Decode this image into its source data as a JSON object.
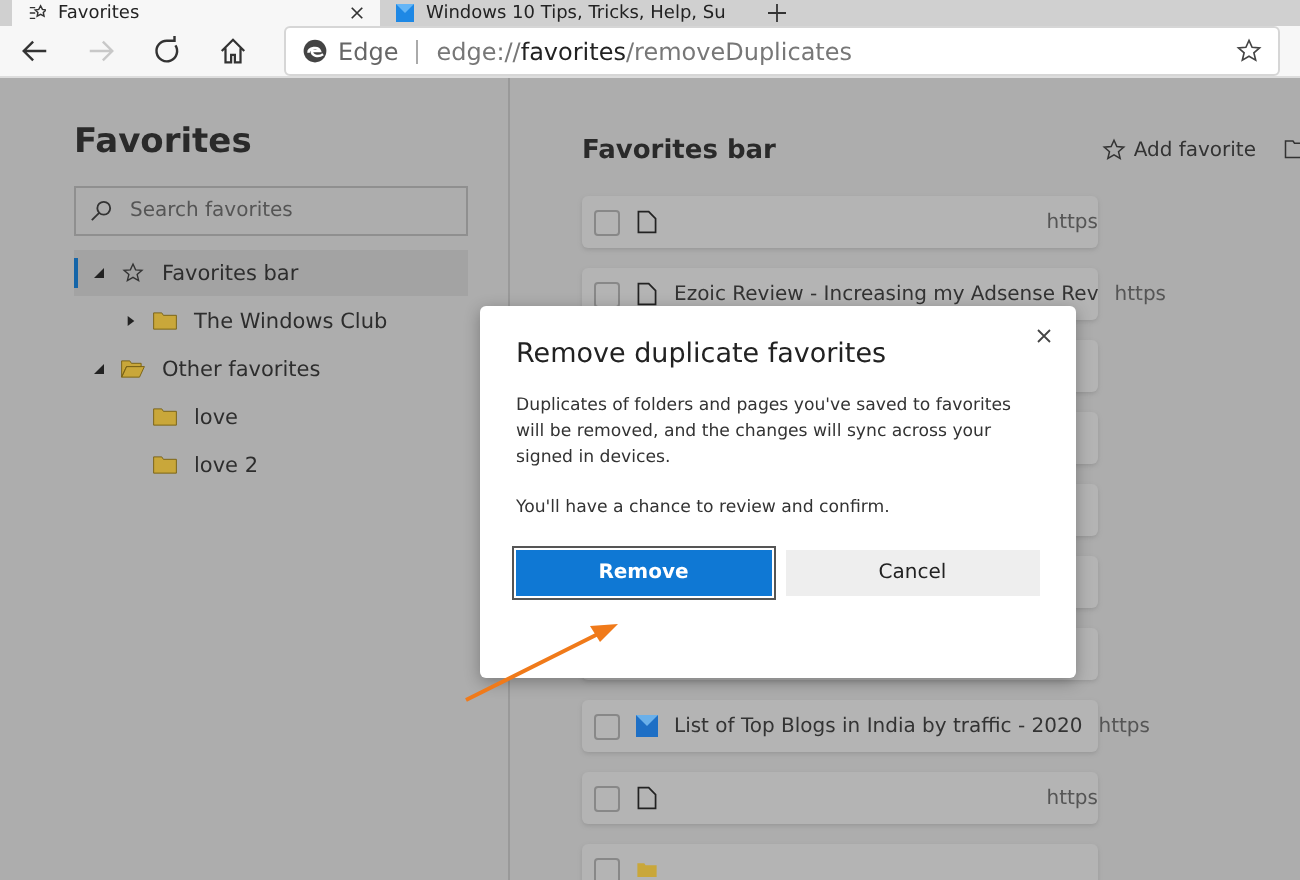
{
  "tabs": [
    {
      "label": "Favorites",
      "selected": true
    },
    {
      "label": "Windows 10 Tips, Tricks, Help, Su",
      "selected": false
    }
  ],
  "toolbar": {
    "forward_disabled": true,
    "address": {
      "brand": "Edge",
      "url": "edge://**favorites**/removeDuplicates"
    }
  },
  "sidebar": {
    "title": "Favorites",
    "search": {
      "placeholder": "Search favorites"
    },
    "tree": [
      {
        "label": "Favorites bar",
        "kind": "star",
        "selected": true,
        "expanded": true,
        "children": [
          {
            "label": "The Windows Club",
            "kind": "folder",
            "selected": false,
            "expanded": false
          }
        ]
      },
      {
        "label": "Other favorites",
        "kind": "folder",
        "selected": false,
        "expanded": true,
        "children": [
          {
            "label": "love",
            "kind": "leaf",
            "selected": false
          },
          {
            "label": "love 2",
            "kind": "leaf",
            "selected": false
          }
        ]
      }
    ]
  },
  "main": {
    "title": "Favorites bar",
    "actions": [
      {
        "label": "Add favorite"
      }
    ],
    "rows": [
      {
        "kind": "page",
        "checked": false,
        "title": "",
        "url": "https"
      },
      {
        "kind": "page",
        "checked": false,
        "title": "Ezoic Review - Increasing my Adsense Rev",
        "url": "https"
      },
      {
        "kind": "covered"
      },
      {
        "kind": "covered"
      },
      {
        "kind": "covered"
      },
      {
        "kind": "covered"
      },
      {
        "kind": "covered"
      },
      {
        "kind": "site",
        "checked": false,
        "title": "List of Top Blogs in India by traffic - 2020",
        "url": "https"
      },
      {
        "kind": "page",
        "checked": false,
        "title": "",
        "url": "https"
      },
      {
        "kind": "folder",
        "checked": false,
        "title": "",
        "url": ""
      }
    ]
  },
  "dialog": {
    "title": "Remove duplicate favorites",
    "body": "Duplicates of folders and pages you've saved to favorites will be removed, and the changes will sync across your signed in devices.",
    "note": "You'll have a chance to review and confirm.",
    "buttons": [
      {
        "label": "Remove",
        "selected": true
      },
      {
        "label": "Cancel",
        "selected": false
      }
    ]
  }
}
